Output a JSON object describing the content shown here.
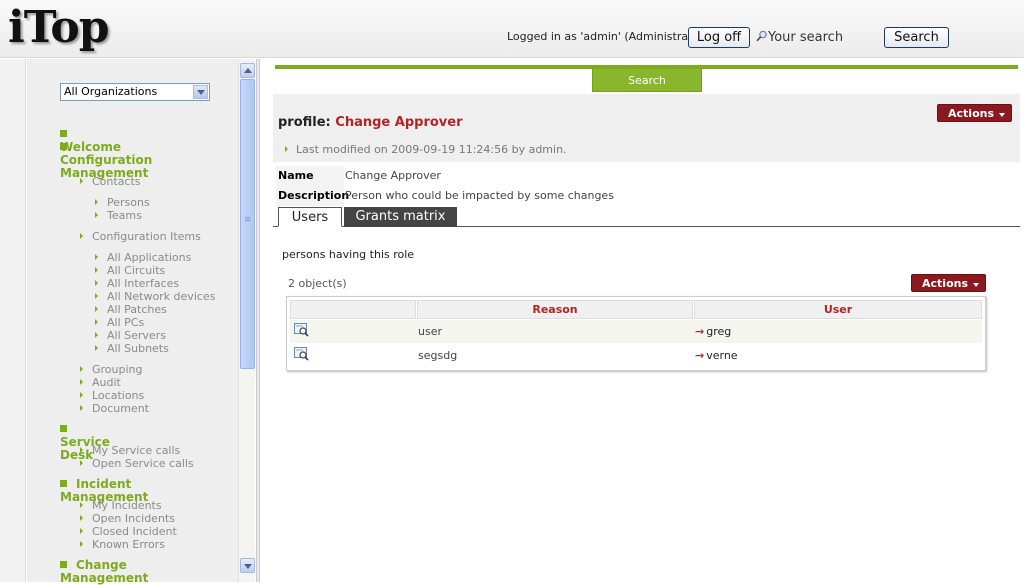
{
  "header": {
    "logo": "iTop",
    "login_text": "Logged in as 'admin' (Administrator)",
    "logoff_label": "Log off",
    "search_placeholder": "Your search",
    "search_label": "Search"
  },
  "sidebar": {
    "org_filter": "All Organizations",
    "menu": [
      {
        "type": "sec",
        "label": "Welcome"
      },
      {
        "type": "sec",
        "label": "Configuration",
        "label2": "Management"
      },
      {
        "type": "grp",
        "label": "Contacts"
      },
      {
        "type": "itm",
        "label": "Persons"
      },
      {
        "type": "itm",
        "label": "Teams"
      },
      {
        "type": "grp",
        "label": "Configuration Items"
      },
      {
        "type": "itm",
        "label": "All Applications"
      },
      {
        "type": "itm",
        "label": "All Circuits"
      },
      {
        "type": "itm",
        "label": "All Interfaces"
      },
      {
        "type": "itm",
        "label": "All Network devices"
      },
      {
        "type": "itm",
        "label": "All Patches"
      },
      {
        "type": "itm",
        "label": "All PCs"
      },
      {
        "type": "itm",
        "label": "All Servers"
      },
      {
        "type": "itm",
        "label": "All Subnets"
      },
      {
        "type": "grp",
        "label": "Grouping"
      },
      {
        "type": "grp",
        "label": "Audit"
      },
      {
        "type": "grp",
        "label": "Locations"
      },
      {
        "type": "grp",
        "label": "Document"
      },
      {
        "type": "sec",
        "label": "Service Desk"
      },
      {
        "type": "grp",
        "label": "My Service calls"
      },
      {
        "type": "grp",
        "label": "Open Service calls"
      },
      {
        "type": "sec",
        "label": "Incident Management"
      },
      {
        "type": "grp",
        "label": "My Incidents"
      },
      {
        "type": "grp",
        "label": "Open Incidents"
      },
      {
        "type": "grp",
        "label": "Closed Incident"
      },
      {
        "type": "grp",
        "label": "Known Errors"
      },
      {
        "type": "sec",
        "label": "Change Management"
      }
    ]
  },
  "main": {
    "search_tab": "Search",
    "title_prefix": "profile:",
    "title_object": "Change Approver",
    "last_modified": "Last modified on 2009-09-19 11:24:56 by admin.",
    "actions_label": "Actions",
    "properties": [
      {
        "label": "Name",
        "value": "Change Approver"
      },
      {
        "label": "Description",
        "value": "Person who could be impacted by some changes"
      }
    ],
    "tabs": [
      {
        "label": "Users",
        "active": true
      },
      {
        "label": "Grants matrix",
        "active": false
      }
    ],
    "list_title": "persons having this role",
    "object_count": "2 object(s)",
    "table": {
      "headers": [
        "",
        "Reason",
        "User"
      ],
      "rows": [
        {
          "reason": "user",
          "user": "greg"
        },
        {
          "reason": "segsdg",
          "user": "verne"
        }
      ]
    }
  },
  "colors": {
    "accent_green": "#7dab1e",
    "action_red": "#8b1a20",
    "title_red": "#b02525"
  },
  "icons": [
    "search-icon",
    "chevron-down-icon",
    "detail-magnifier-icon",
    "right-arrow-icon"
  ]
}
